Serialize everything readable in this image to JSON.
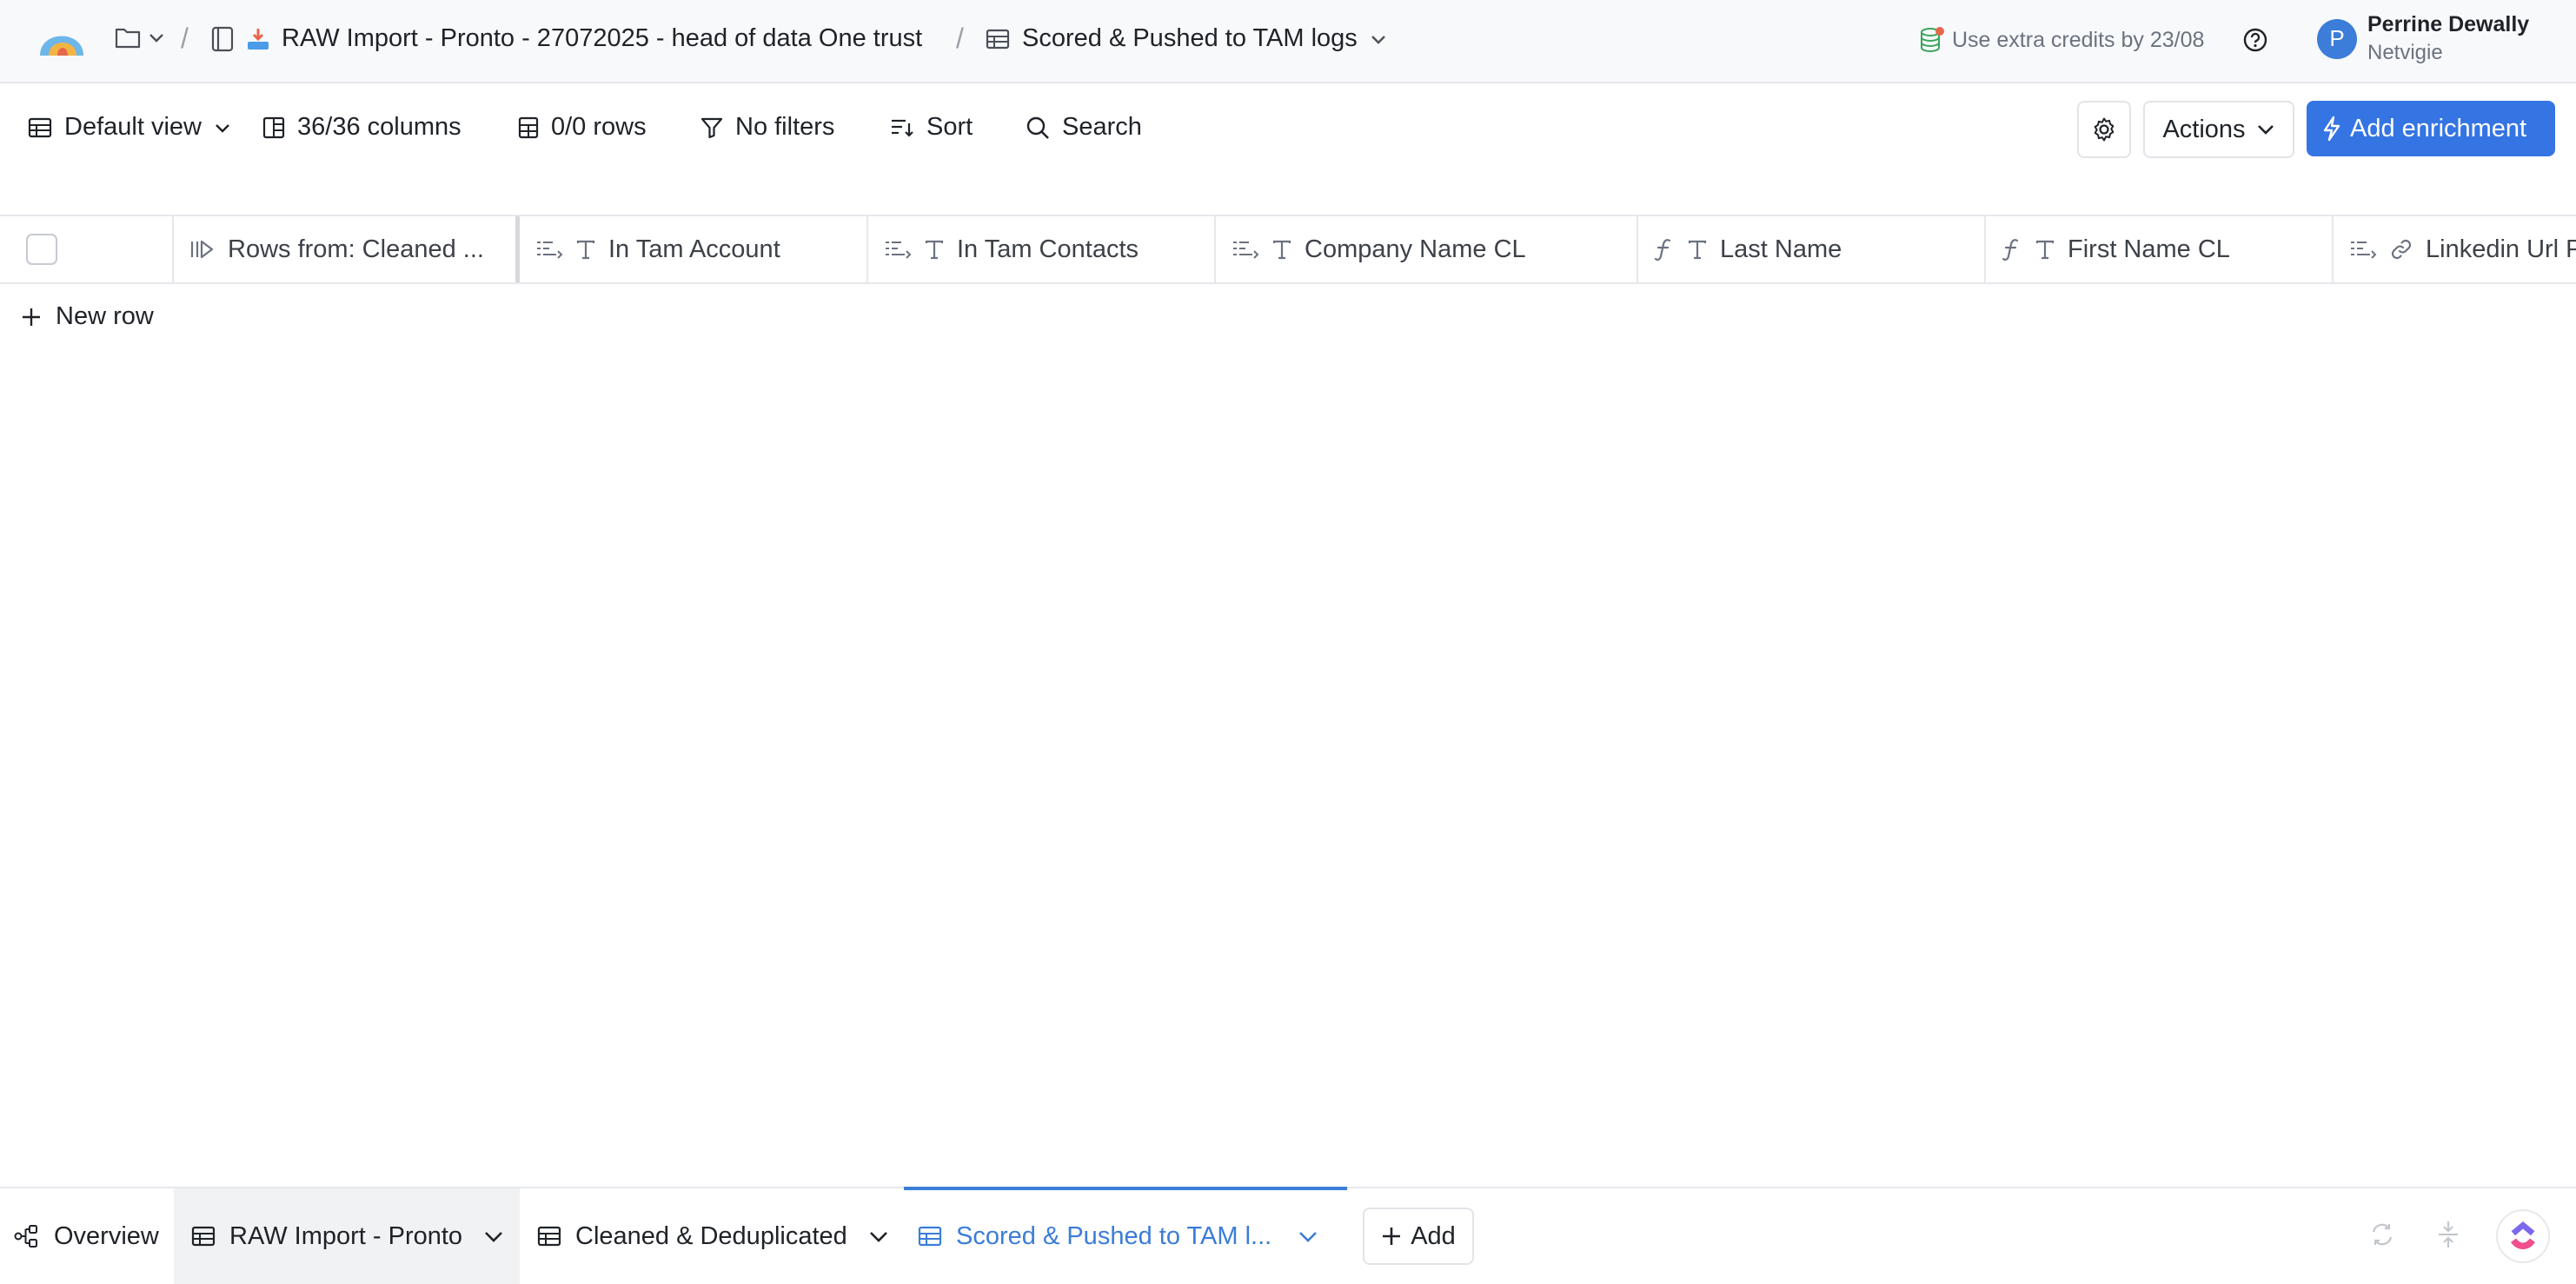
{
  "breadcrumb": {
    "workbook_label": "RAW Import - Pronto - 27072025 - head of data One trust",
    "table_label": "Scored & Pushed to TAM logs"
  },
  "credits": {
    "text": "Use extra credits by 23/08"
  },
  "user": {
    "initial": "P",
    "name": "Perrine Dewally",
    "org": "Netvigie"
  },
  "toolbar": {
    "view_label": "Default view",
    "columns_label": "36/36 columns",
    "rows_label": "0/0 rows",
    "filters_label": "No filters",
    "sort_label": "Sort",
    "search_label": "Search",
    "actions_label": "Actions",
    "add_enrichment_label": "Add enrichment"
  },
  "columns": [
    {
      "label": "Rows from: Cleaned ...",
      "icon": "source-rows-icon"
    },
    {
      "label": "In Tam Account",
      "icon": "text-type-icon"
    },
    {
      "label": "In Tam Contacts",
      "icon": "text-type-icon"
    },
    {
      "label": "Company Name CL",
      "icon": "text-type-icon"
    },
    {
      "label": "Last Name",
      "icon": "formula-text-icon"
    },
    {
      "label": "First Name CL",
      "icon": "formula-text-icon"
    },
    {
      "label": "Linkedin Url P",
      "icon": "link-icon"
    }
  ],
  "table": {
    "new_row_label": "New row"
  },
  "bottom_tabs": {
    "overview": "Overview",
    "raw_import": "RAW Import - Pronto",
    "cleaned": "Cleaned & Deduplicated",
    "scored": "Scored & Pushed to TAM l...",
    "add": "Add"
  },
  "colors": {
    "accent": "#3574e3",
    "active_tab": "#3b7dd8"
  }
}
